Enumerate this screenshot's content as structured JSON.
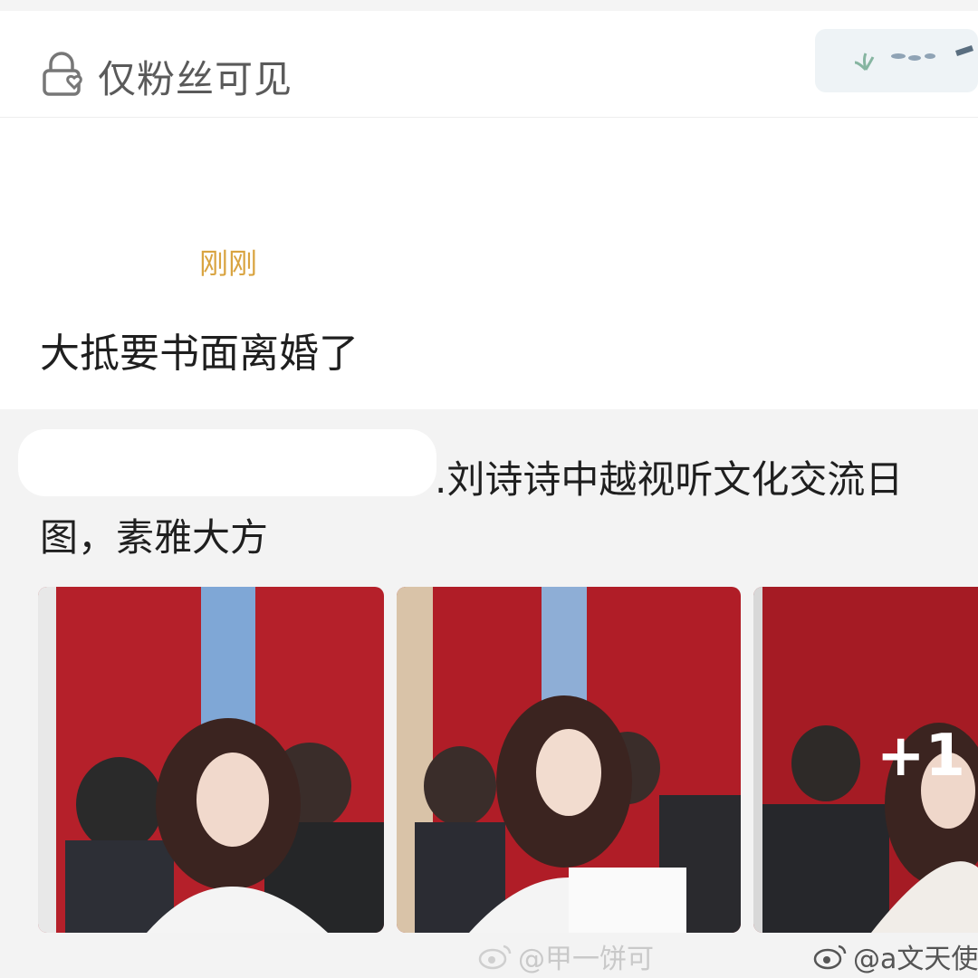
{
  "header": {
    "visibility_label": "仅粉丝可见"
  },
  "post": {
    "timestamp": "刚刚",
    "text": "大抵要书面离婚了"
  },
  "repost": {
    "line1": ".刘诗诗中越视听文化交流日",
    "line2": "图，素雅大方",
    "photos": [
      {
        "alt": "photo-1"
      },
      {
        "alt": "photo-2"
      },
      {
        "alt": "photo-3"
      }
    ],
    "more_count": "+1"
  },
  "watermarks": {
    "first": "@甲一饼可",
    "second": "@a文天使"
  },
  "colors": {
    "timestamp": "#d9a441",
    "text": "#1f1f1f",
    "header_label": "#5a5a5a"
  },
  "icons": {
    "visibility": "lock-heart-icon",
    "watermark": "weibo-icon"
  }
}
